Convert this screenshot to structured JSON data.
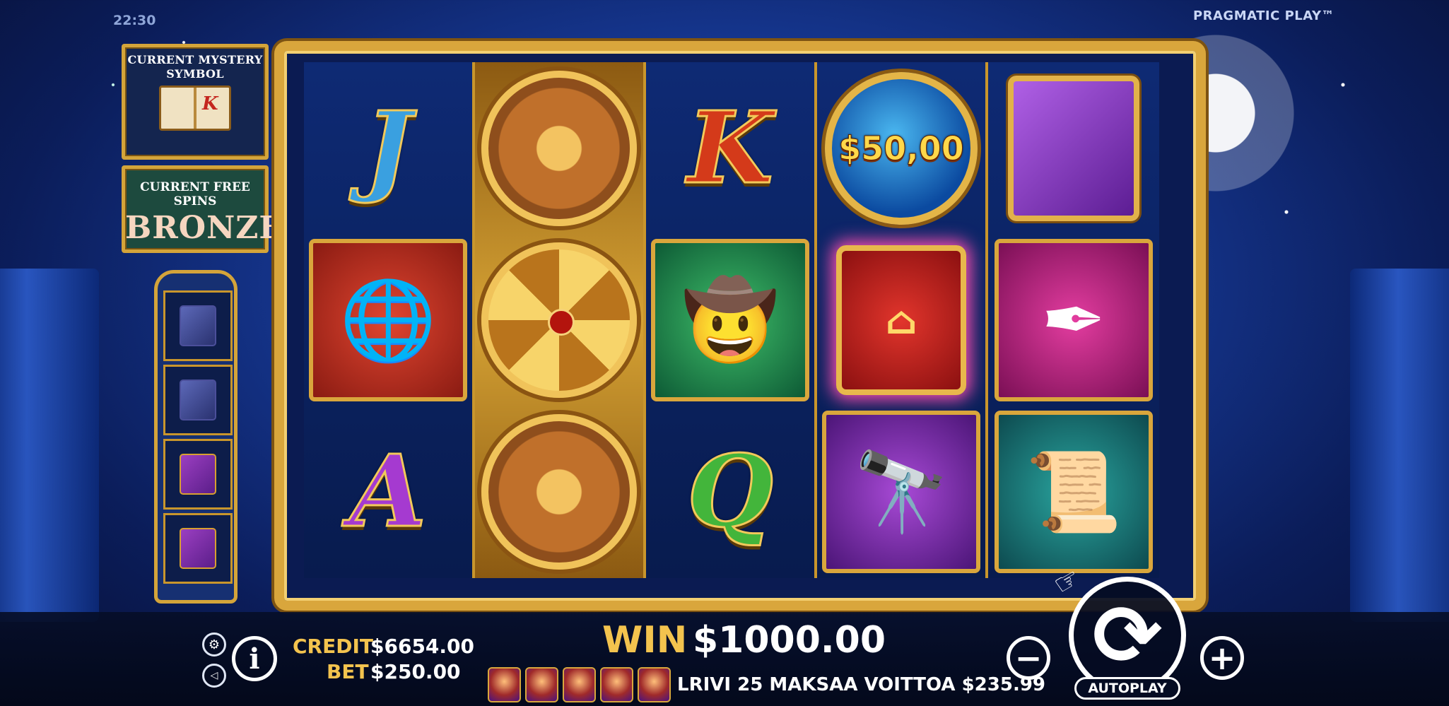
{
  "status": {
    "clock": "22:30",
    "brand": "PRAGMATIC PLAY™"
  },
  "mystery": {
    "title": "CURRENT MYSTERY SYMBOL",
    "symbol": "K"
  },
  "free_spins": {
    "title": "CURRENT FREE SPINS",
    "level": "BRONZE"
  },
  "tower": {
    "slots": [
      "book-blue-icon",
      "book-blue-icon",
      "book-gold-icon",
      "book-gold-icon"
    ]
  },
  "reels": [
    [
      "J",
      "armillary-sphere-icon",
      "A"
    ],
    [
      "compass-icon",
      "compass-star-icon",
      "compass-icon"
    ],
    [
      "K",
      "explorer-icon",
      "Q"
    ],
    [
      "$50,00",
      "red-book-icon",
      "telescope-icon"
    ],
    [
      "purple-book-icon",
      "quill-inkwell-icon",
      "treasure-map-icon"
    ]
  ],
  "hud": {
    "credit_label": "CREDIT",
    "credit_value": "$6654.00",
    "bet_label": "BET",
    "bet_value": "$250.00",
    "win_label": "WIN",
    "win_value": "$1000.00",
    "line_text": "LRIVI 25 MAKSAA VOITTOA $235.99",
    "winning_symbols": 5,
    "minus": "−",
    "plus": "+",
    "autoplay": "AUTOPLAY",
    "info": "i"
  },
  "colors": {
    "gold": "#d9a63c",
    "label_gold": "#f3c34e",
    "reel_bg": "#0b1b52"
  }
}
